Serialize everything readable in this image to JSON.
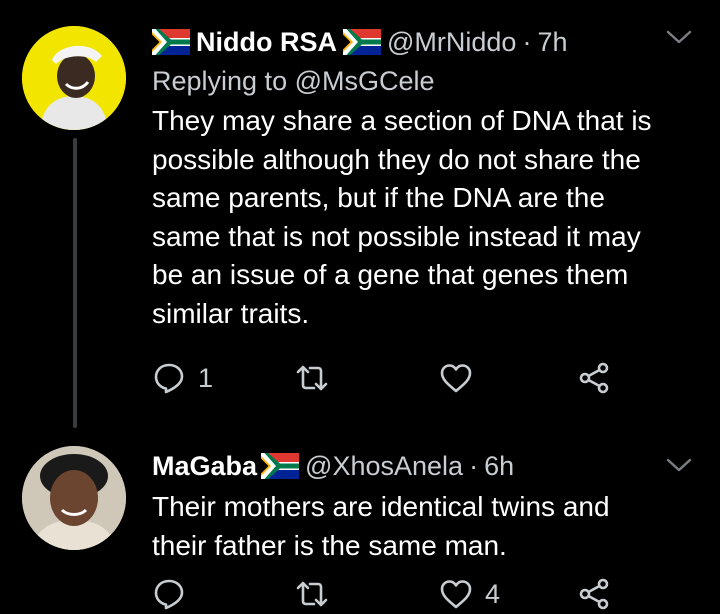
{
  "tweets": [
    {
      "name": "Niddo RSA",
      "handle": "@MrNiddo",
      "dot": "·",
      "time": "7h",
      "reply_to": "Replying to @MsGCele",
      "text": "They may share a section of DNA that is possible although they do not share the same parents, but if the DNA are the same that is not possible instead it may be an issue of a gene that genes them similar traits.",
      "reply_count": "1",
      "retweet_count": "",
      "like_count": ""
    },
    {
      "name": "MaGaba",
      "handle": "@XhosAnela",
      "dot": "·",
      "time": "6h",
      "text": "Their mothers are identical twins and their father is the same man.",
      "reply_count": "",
      "retweet_count": "",
      "like_count": "4"
    }
  ],
  "icons": {
    "reply": "reply-icon",
    "retweet": "retweet-icon",
    "like": "heart-icon",
    "share": "share-icon",
    "menu": "chevron-down-icon",
    "flag": "south-africa-flag-icon"
  },
  "colors": {
    "background": "#000000",
    "text": "#ffffff",
    "secondary": "#c8cdd1",
    "thread_line": "#3a3d40"
  }
}
